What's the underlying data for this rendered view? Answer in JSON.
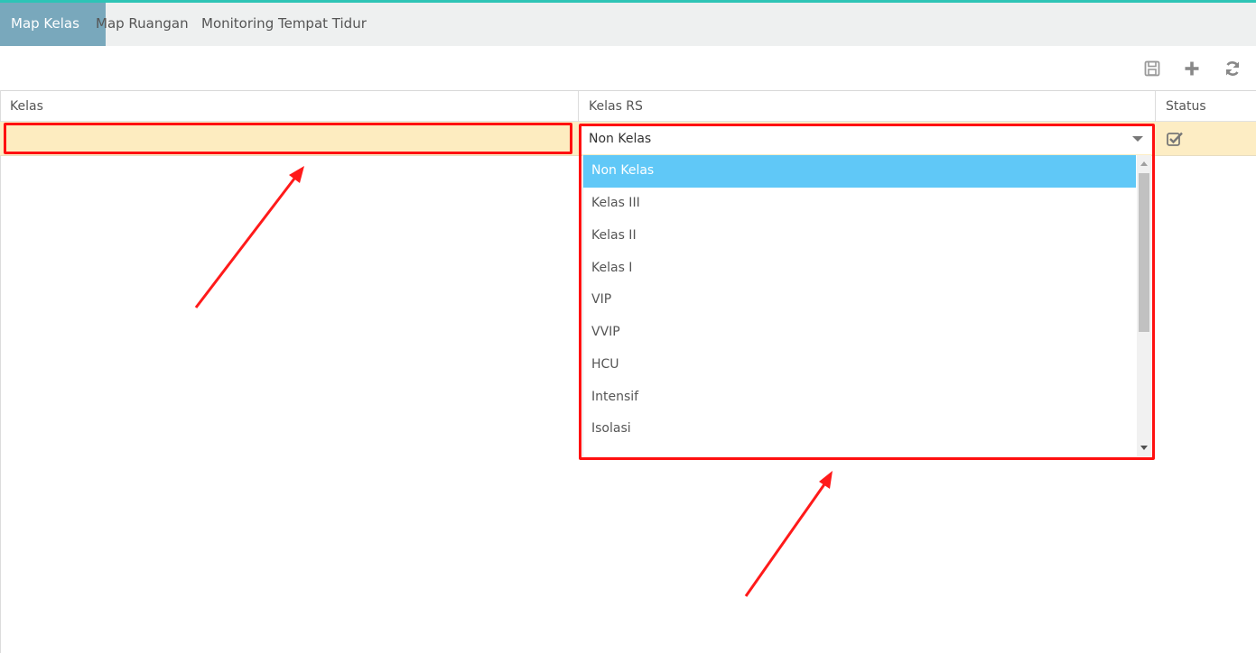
{
  "tabs": [
    {
      "label": "Map Kelas",
      "active": true
    },
    {
      "label": "Map Ruangan",
      "active": false
    },
    {
      "label": "Monitoring Tempat Tidur",
      "active": false
    }
  ],
  "toolbar": {
    "icons": [
      "save-icon",
      "plus-icon",
      "refresh-icon"
    ]
  },
  "grid": {
    "columns": [
      "Kelas",
      "Kelas RS",
      "Status"
    ],
    "row": {
      "kelas_value": "",
      "kelas_rs_value": "Non Kelas",
      "status_checked": true
    }
  },
  "dropdown": {
    "selected": "Non Kelas",
    "options": [
      "Non Kelas",
      "Kelas III",
      "Kelas II",
      "Kelas I",
      "VIP",
      "VVIP",
      "HCU",
      "Intensif",
      "Isolasi"
    ]
  },
  "colors": {
    "accent_line": "#2ec4b6",
    "active_tab": "#79a8bc",
    "row_highlight": "#fdedc4",
    "selected_option": "#60c8f7",
    "annotation_red": "#ff1010"
  }
}
